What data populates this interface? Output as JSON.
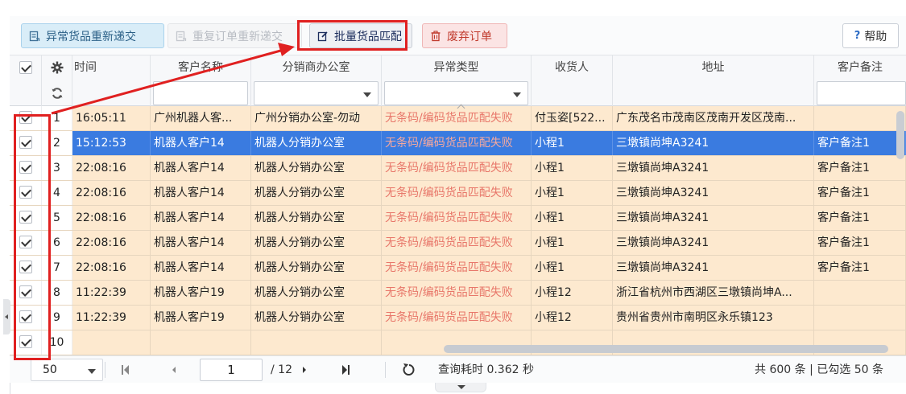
{
  "toolbar": {
    "btn_abnormal_resubmit": "异常货品重新递交",
    "btn_duplicate_resubmit": "重复订单重新递交",
    "btn_batch_match": "批量货品匹配",
    "btn_discard_order": "废弃订单",
    "btn_help": "帮助",
    "help_glyph": "?"
  },
  "columns": {
    "time": "时间",
    "customer": "客户名称",
    "office": "分销商办公室",
    "error": "异常类型",
    "receiver": "收货人",
    "address": "地址",
    "note": "客户备注"
  },
  "rows": [
    {
      "num": "1",
      "time": "16:05:11",
      "customer": "广州机器人客...",
      "office": "广州分销办公室-勿动",
      "error": "无条码/编码货品匹配失败",
      "receiver": "付玉姿[522...",
      "address": "广东茂名市茂南区茂南开发区茂南...",
      "note": ""
    },
    {
      "num": "2",
      "time": "15:12:53",
      "customer": "机器人客户14",
      "office": "机器人分销办公室",
      "error": "无条码/编码货品匹配失败",
      "receiver": "小程1",
      "address": "三墩镇尚坤A3241",
      "note": "客户备注1"
    },
    {
      "num": "3",
      "time": "22:08:16",
      "customer": "机器人客户14",
      "office": "机器人分销办公室",
      "error": "无条码/编码货品匹配失败",
      "receiver": "小程1",
      "address": "三墩镇尚坤A3241",
      "note": "客户备注1"
    },
    {
      "num": "4",
      "time": "22:08:16",
      "customer": "机器人客户14",
      "office": "机器人分销办公室",
      "error": "无条码/编码货品匹配失败",
      "receiver": "小程1",
      "address": "三墩镇尚坤A3241",
      "note": "客户备注1"
    },
    {
      "num": "5",
      "time": "22:08:16",
      "customer": "机器人客户14",
      "office": "机器人分销办公室",
      "error": "无条码/编码货品匹配失败",
      "receiver": "小程1",
      "address": "三墩镇尚坤A3241",
      "note": "客户备注1"
    },
    {
      "num": "6",
      "time": "22:08:16",
      "customer": "机器人客户14",
      "office": "机器人分销办公室",
      "error": "无条码/编码货品匹配失败",
      "receiver": "小程1",
      "address": "三墩镇尚坤A3241",
      "note": "客户备注1"
    },
    {
      "num": "7",
      "time": "22:08:16",
      "customer": "机器人客户14",
      "office": "机器人分销办公室",
      "error": "无条码/编码货品匹配失败",
      "receiver": "小程1",
      "address": "三墩镇尚坤A3241",
      "note": "客户备注1"
    },
    {
      "num": "8",
      "time": "11:22:39",
      "customer": "机器人客户19",
      "office": "机器人分销办公室",
      "error": "无条码/编码货品匹配失败",
      "receiver": "小程12",
      "address": "浙江省杭州市西湖区三墩镇尚坤A...",
      "note": ""
    },
    {
      "num": "9",
      "time": "11:22:39",
      "customer": "机器人客户19",
      "office": "机器人分销办公室",
      "error": "无条码/编码货品匹配失败",
      "receiver": "小程12",
      "address": "贵州省贵州市南明区永乐镇123",
      "note": ""
    },
    {
      "num": "10",
      "time": "",
      "customer": "",
      "office": "",
      "error": "",
      "receiver": "",
      "address": "",
      "note": ""
    }
  ],
  "footer": {
    "page_size": "50",
    "current_page": "1",
    "total_pages": "/ 12",
    "query_time": "查询耗时 0.362 秒",
    "summary": "共 600 条 | 已勾选 50 条"
  },
  "colors": {
    "highlight_red": "#e02020",
    "selected_row": "#3a7be0",
    "warn_row": "#fde9cf",
    "error_text": "#e8776a"
  }
}
